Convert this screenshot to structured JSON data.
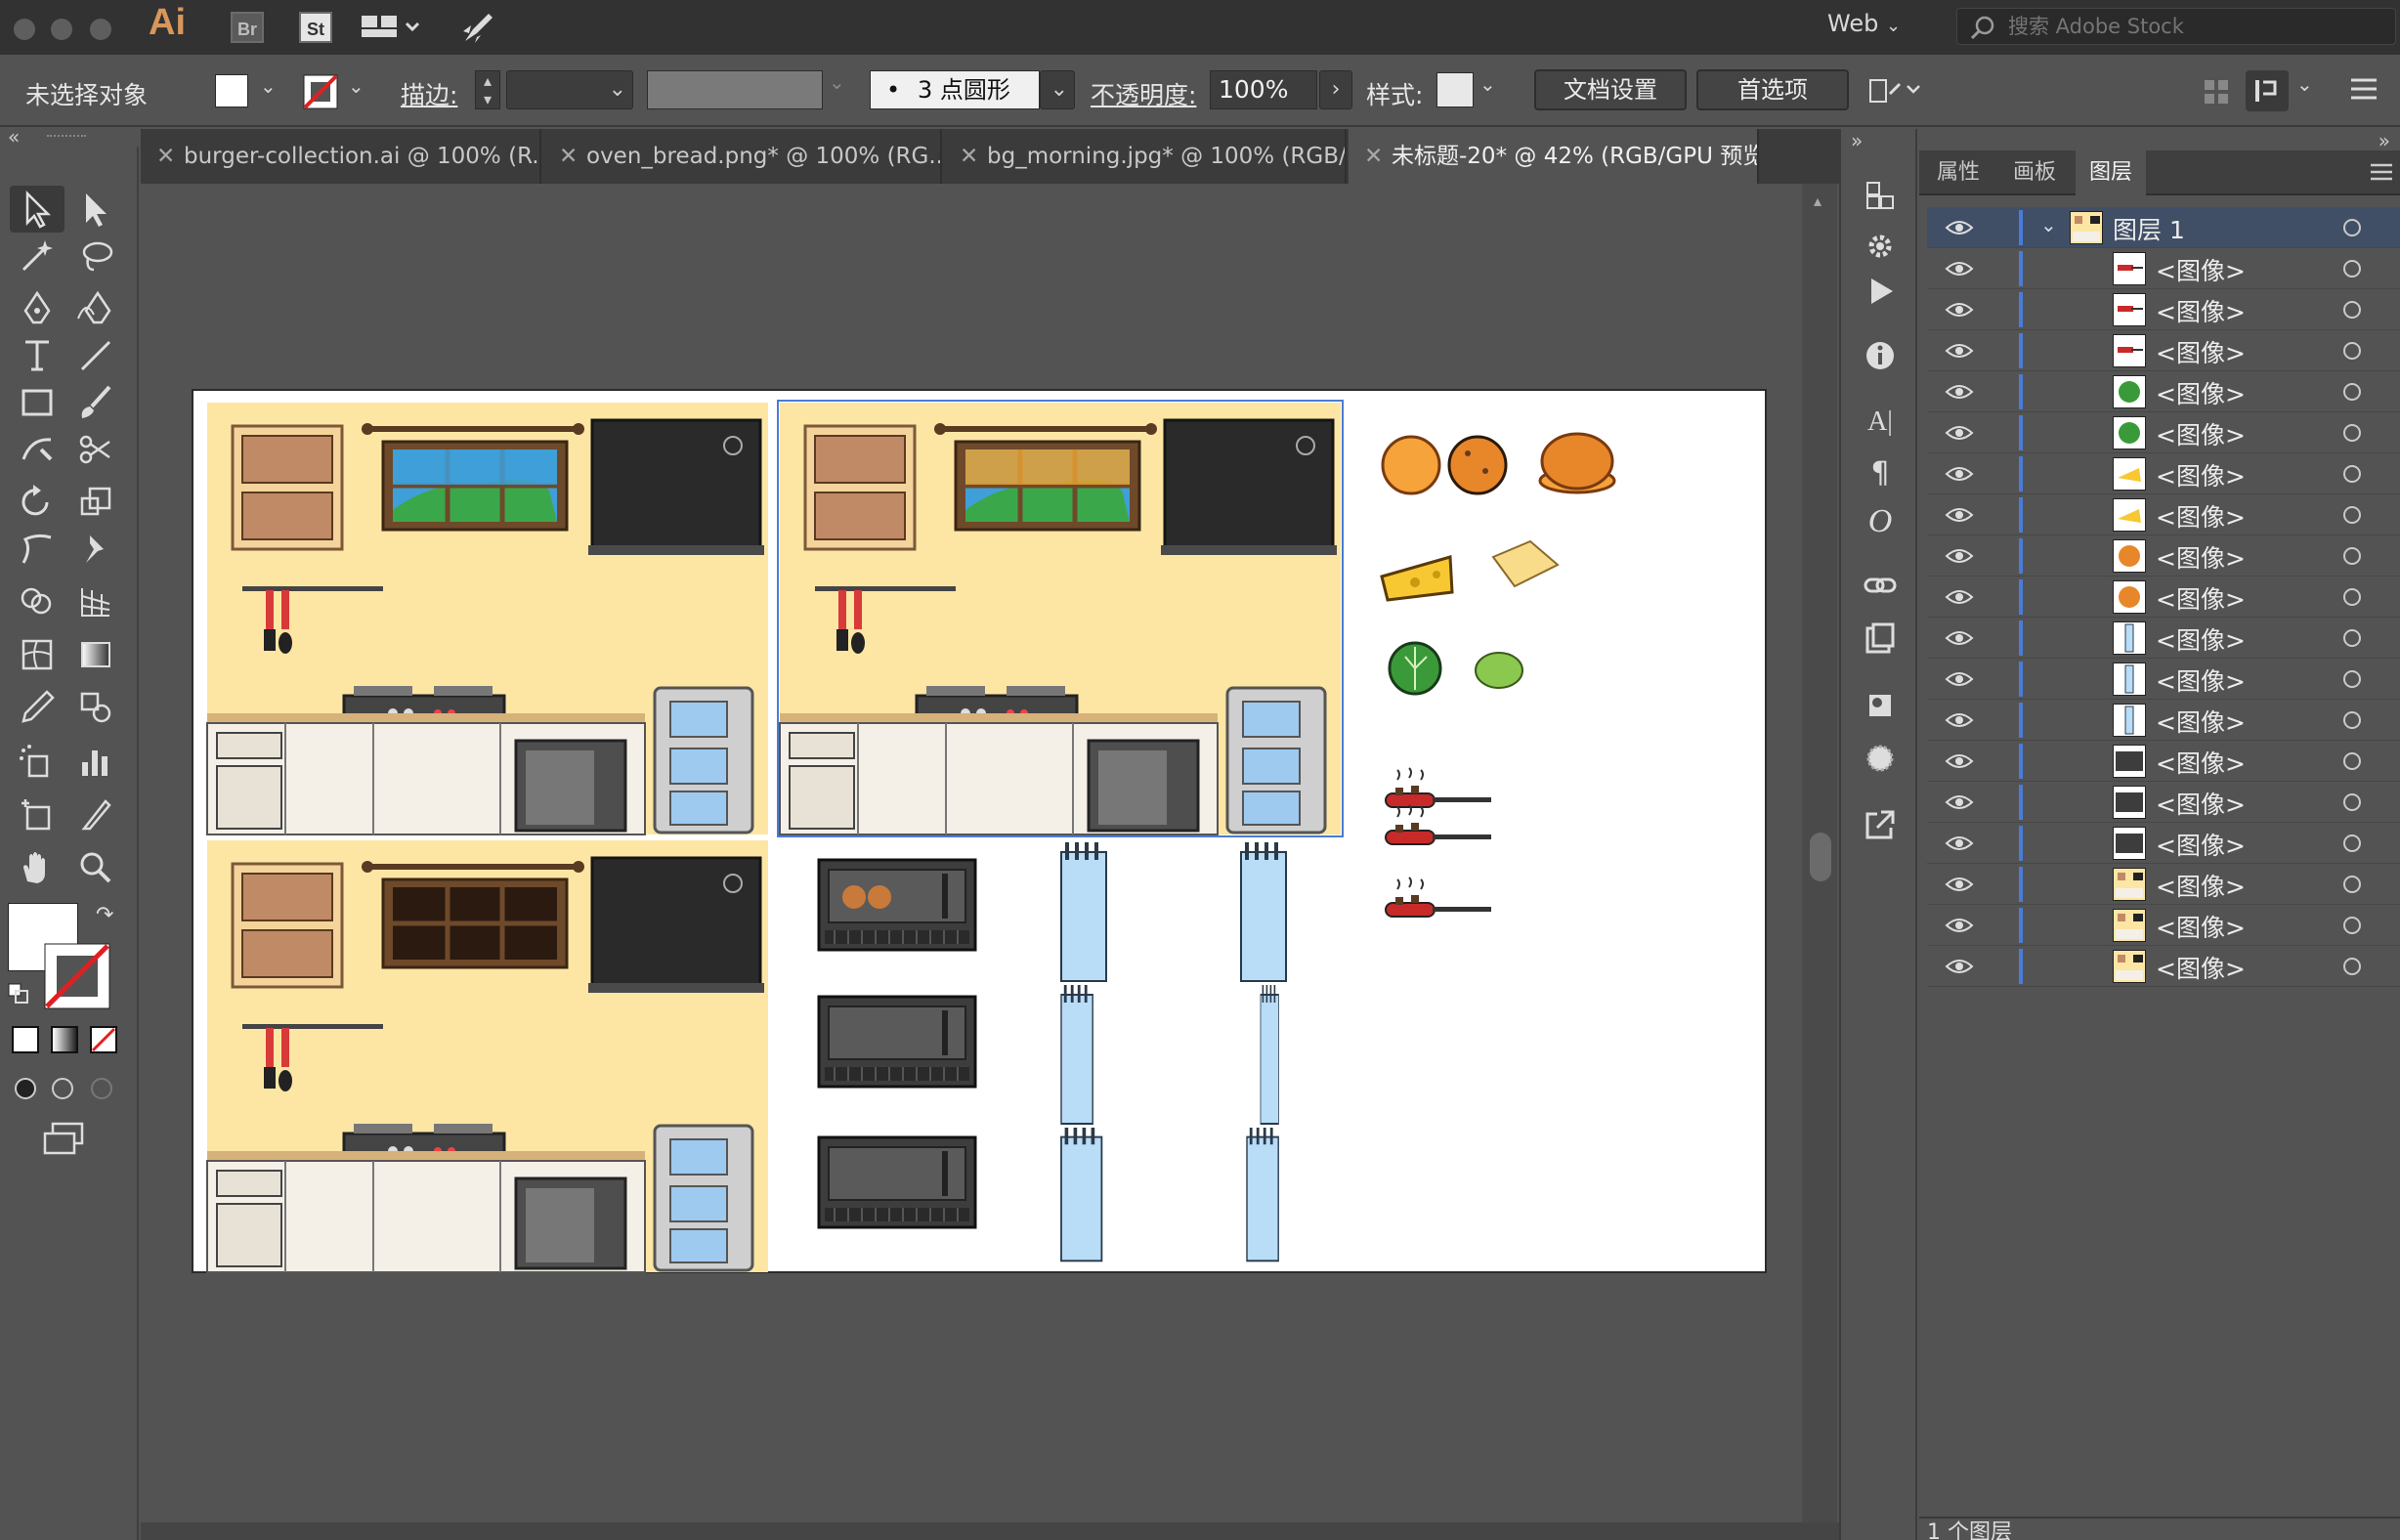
{
  "app": {
    "logo": "Ai",
    "bridge": "Br",
    "stock": "St",
    "workspace": "Web",
    "stock_search_placeholder": "搜索 Adobe Stock"
  },
  "control": {
    "selection": "未选择对象",
    "stroke_label": "描边:",
    "brush": "3 点圆形",
    "opacity_label": "不透明度:",
    "opacity_value": "100%",
    "style_label": "样式:",
    "doc_setup": "文档设置",
    "prefs": "首选项"
  },
  "tabs": [
    {
      "label": "burger-collection.ai @ 100% (R..."
    },
    {
      "label": "oven_bread.png* @ 100% (RG..."
    },
    {
      "label": "bg_morning.jpg* @ 100% (RGB/..."
    },
    {
      "label": "未标题-20* @ 42% (RGB/GPU 预览)"
    }
  ],
  "panel": {
    "tabs": [
      {
        "label": "属性"
      },
      {
        "label": "画板"
      },
      {
        "label": "图层"
      }
    ],
    "layer_name": "图层 1",
    "items": [
      {
        "label": "<图像>",
        "kind": "pan"
      },
      {
        "label": "<图像>",
        "kind": "pan"
      },
      {
        "label": "<图像>",
        "kind": "pan"
      },
      {
        "label": "<图像>",
        "kind": "lettuce"
      },
      {
        "label": "<图像>",
        "kind": "lettuce"
      },
      {
        "label": "<图像>",
        "kind": "cheese"
      },
      {
        "label": "<图像>",
        "kind": "cheese"
      },
      {
        "label": "<图像>",
        "kind": "bun"
      },
      {
        "label": "<图像>",
        "kind": "bun"
      },
      {
        "label": "<图像>",
        "kind": "glass"
      },
      {
        "label": "<图像>",
        "kind": "glass"
      },
      {
        "label": "<图像>",
        "kind": "glass"
      },
      {
        "label": "<图像>",
        "kind": "oven"
      },
      {
        "label": "<图像>",
        "kind": "oven"
      },
      {
        "label": "<图像>",
        "kind": "oven"
      },
      {
        "label": "<图像>",
        "kind": "kitchen"
      },
      {
        "label": "<图像>",
        "kind": "kitchen"
      },
      {
        "label": "<图像>",
        "kind": "kitchen"
      }
    ],
    "footer": "1 个图层"
  },
  "colors": {
    "accent": "#4a7bd8",
    "kitchen_bg": "#fde6a4",
    "window_sky": "#3f9fd8",
    "window_sunset": "#e8a030",
    "hill": "#3aa84a",
    "pan_red": "#c82a2a",
    "glass": "#b9dcf7"
  }
}
